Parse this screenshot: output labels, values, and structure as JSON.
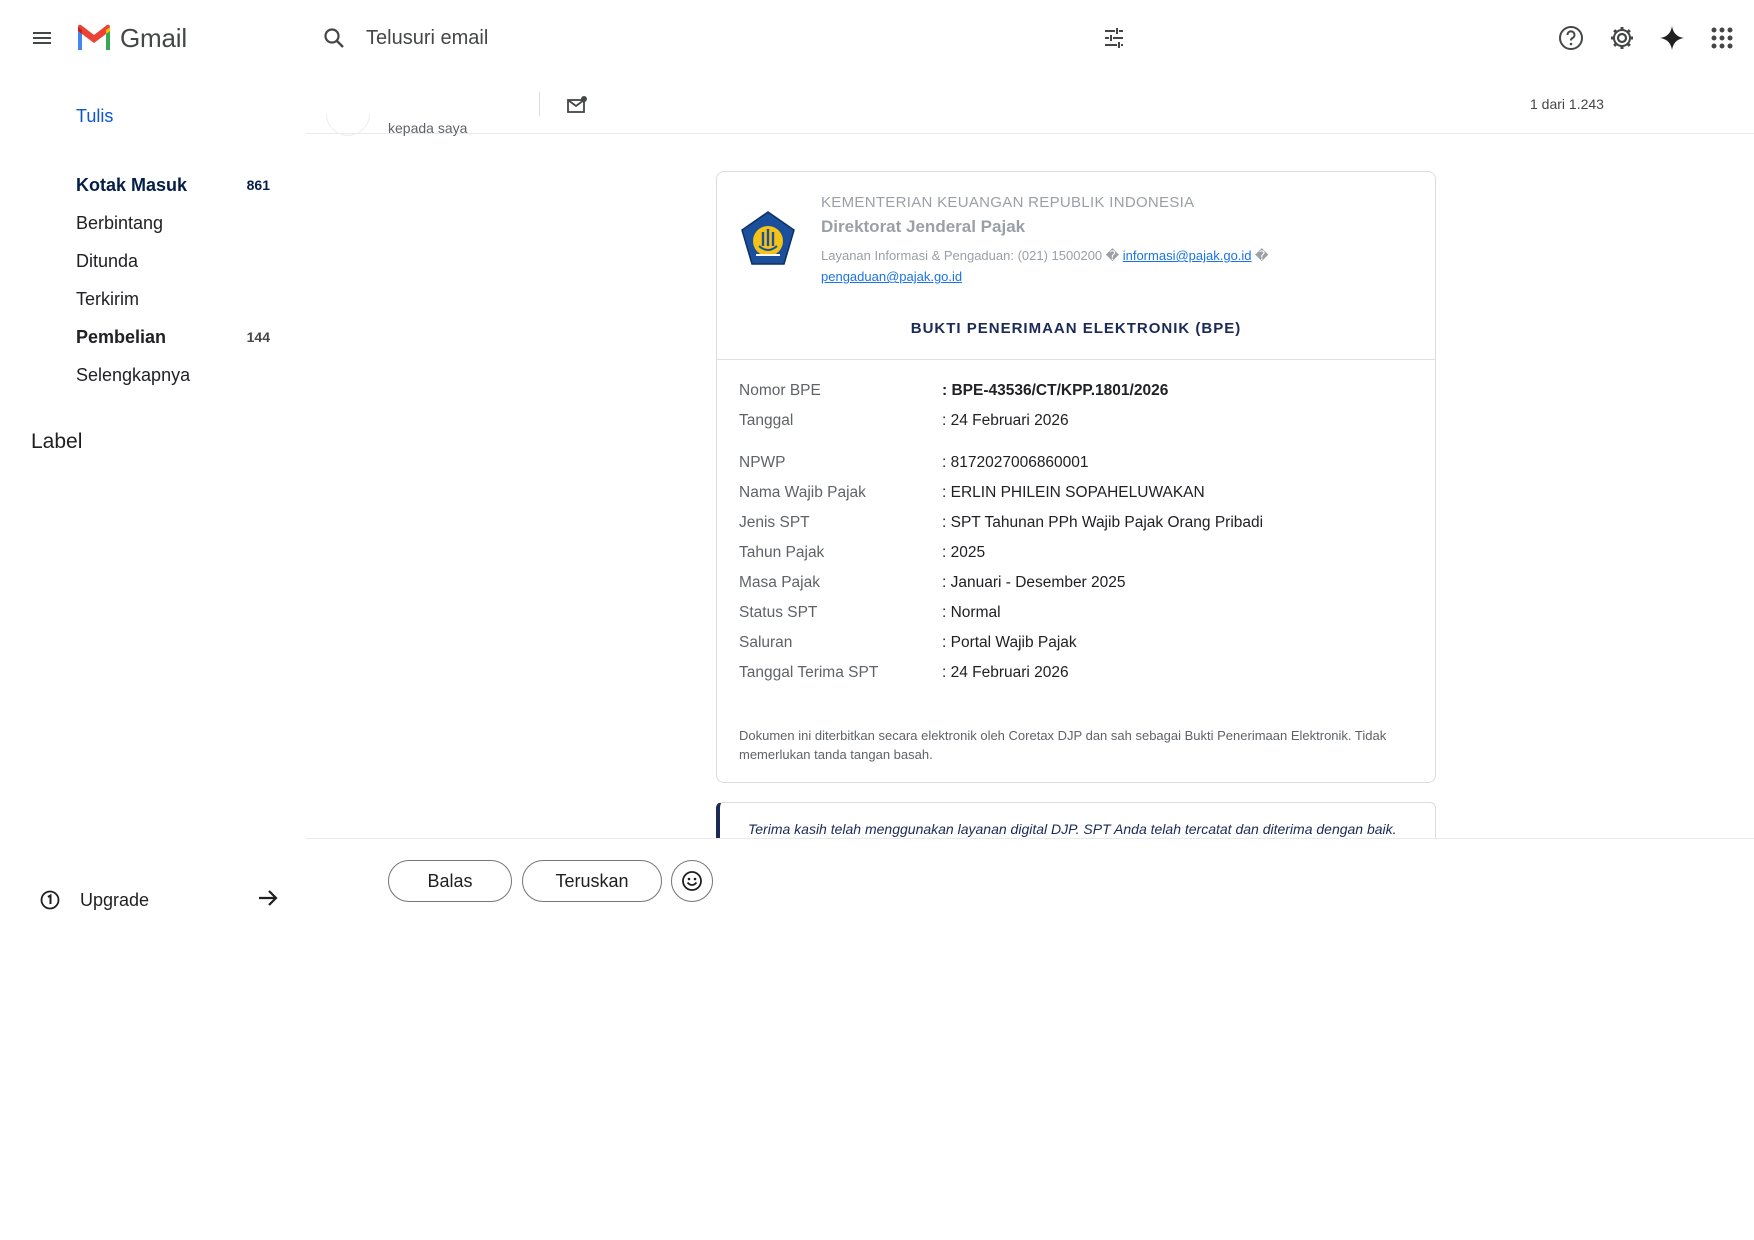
{
  "app": {
    "name": "Gmail",
    "brand_colors": {
      "red": "#EA4335",
      "blue": "#4285F4",
      "green": "#34A853",
      "yellow": "#FBBC04"
    }
  },
  "search": {
    "placeholder": "Telusuri email"
  },
  "header_icons": [
    "menu-icon",
    "search-icon",
    "filter-icon",
    "help-icon",
    "settings-icon",
    "gemini-icon",
    "apps-icon"
  ],
  "sidebar": {
    "compose_label": "Tulis",
    "items": [
      {
        "label": "Kotak Masuk",
        "count": "861"
      },
      {
        "label": "Berbintang",
        "count": ""
      },
      {
        "label": "Ditunda",
        "count": ""
      },
      {
        "label": "Terkirim",
        "count": ""
      },
      {
        "label": "Pembelian",
        "count": "144"
      },
      {
        "label": "Selengkapnya",
        "count": ""
      }
    ],
    "labels_heading": "Label",
    "upgrade_label": "Upgrade"
  },
  "toolbar": {
    "pager": "1 dari 1.243",
    "recipient_line": "kepada saya"
  },
  "email": {
    "org_ministry": "KEMENTERIAN KEUANGAN REPUBLIK INDONESIA",
    "org_name": "Direktorat Jenderal Pajak",
    "contact_prefix": "Layanan Informasi & Pengaduan: (021) 1500200 � ",
    "contact_email_1": "informasi@pajak.go.id",
    "contact_sep": " �",
    "contact_email_2": "pengaduan@pajak.go.id",
    "title": "BUKTI PENERIMAAN ELEKTRONIK (BPE)",
    "fields": [
      {
        "key": "Nomor BPE",
        "value": ": BPE-43536/CT/KPP.1801/2026"
      },
      {
        "key": "Tanggal",
        "value": ": 24 Februari 2026"
      },
      {
        "key": "NPWP",
        "value": ": 8172027006860001"
      },
      {
        "key": "Nama Wajib Pajak",
        "value": ": ERLIN PHILEIN SOPAHELUWAKAN"
      },
      {
        "key": "Jenis SPT",
        "value": ": SPT Tahunan PPh Wajib Pajak Orang Pribadi"
      },
      {
        "key": "Tahun Pajak",
        "value": ": 2025"
      },
      {
        "key": "Masa Pajak",
        "value": ": Januari - Desember 2025"
      },
      {
        "key": "Status SPT",
        "value": ": Normal"
      },
      {
        "key": "Saluran",
        "value": ": Portal Wajib Pajak"
      },
      {
        "key": "Tanggal Terima SPT",
        "value": ": 24 Februari 2026"
      }
    ],
    "footer": "Dokumen ini diterbitkan secara elektronik oleh Coretax DJP dan sah sebagai Bukti Penerimaan Elektronik. Tidak memerlukan tanda tangan basah.",
    "thanks_note": "Terima kasih telah menggunakan layanan digital DJP. SPT Anda telah tercatat dan diterima dengan baik."
  },
  "reply": {
    "reply_label": "Balas",
    "forward_label": "Teruskan"
  }
}
